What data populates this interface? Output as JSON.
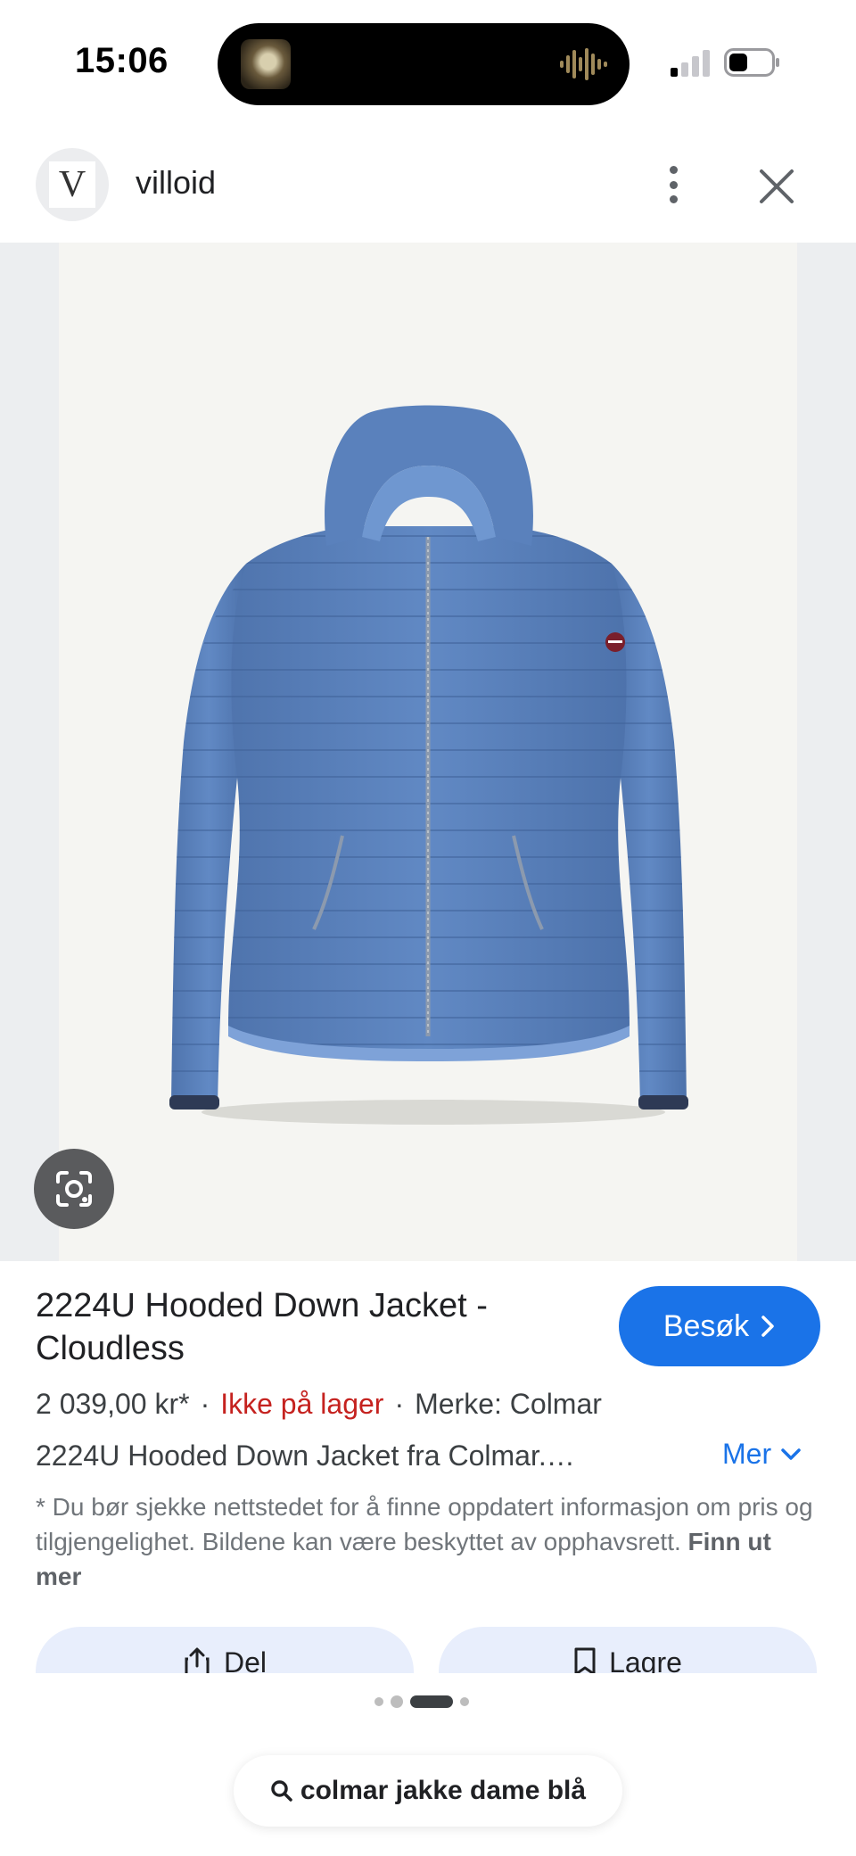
{
  "status_bar": {
    "time": "15:06",
    "battery_level": 0.4,
    "signal_bars": 1
  },
  "header": {
    "site_logo_letter": "V",
    "site_name": "villoid"
  },
  "product": {
    "title": "2224U Hooded Down Jacket - Cloudless",
    "visit_label": "Besøk",
    "price": "2 039,00 kr*",
    "stock_status": "Ikke på lager",
    "brand": "Merke: Colmar",
    "separator": "·",
    "description": "2224U Hooded Down Jacket fra Colmar.…",
    "more_label": "Mer"
  },
  "disclaimer": {
    "text": "* Du bør sjekke nettstedet for å finne oppdatert informasjon om pris og tilgjengelighet. Bildene kan være beskyttet av opphavsrett. ",
    "link": "Finn ut mer"
  },
  "actions": {
    "share_label": "Del",
    "save_label": "Lagre"
  },
  "pagination": {
    "count": 4,
    "active_index": 2
  },
  "search": {
    "query": "colmar jakke dame blå"
  },
  "colors": {
    "accent": "#1a73e8",
    "out_of_stock": "#c5221f",
    "jacket": "#5b82bd",
    "image_background": "#f5f5f2"
  }
}
